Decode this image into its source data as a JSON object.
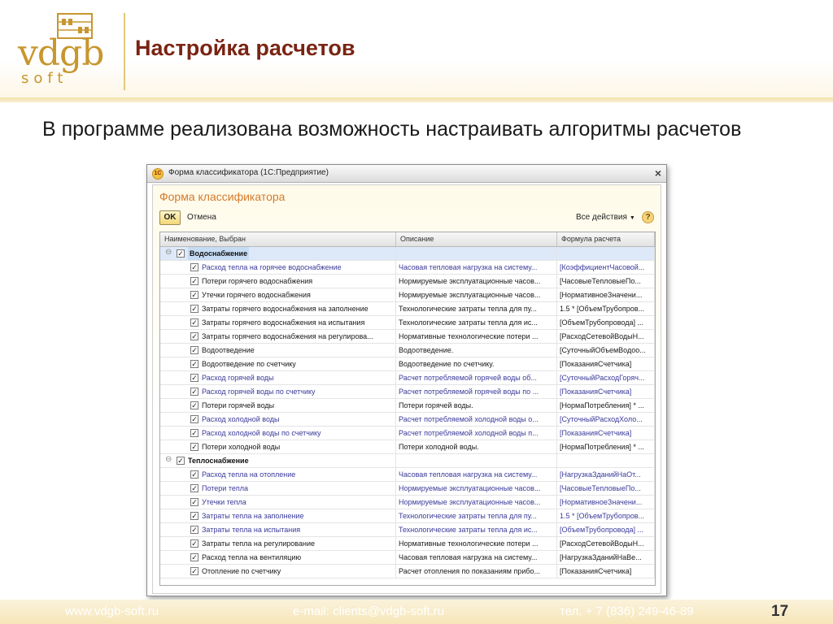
{
  "header": {
    "logo_text": "vdgb",
    "logo_sub": "soft",
    "title": "Настройка расчетов"
  },
  "body_text": "В программе реализована возможность настраивать алгоритмы расчетов",
  "window": {
    "app_icon": "1С",
    "title": "Форма классификатора  (1С:Предприятие)",
    "close_icon": "×",
    "form_title": "Форма классификатора",
    "toolbar": {
      "ok_label": "OK",
      "cancel_label": "Отмена",
      "actions_label": "Все действия",
      "help_label": "?"
    },
    "columns": [
      "Наименование, Выбран",
      "Описание",
      "Формула расчета"
    ],
    "rows": [
      {
        "type": "group",
        "name": "Водоснабжение",
        "desc": "",
        "formula": "",
        "checked": true
      },
      {
        "type": "child",
        "style": "link",
        "name": "Расход тепла на горячее водоснабжение",
        "desc": "Часовая тепловая нагрузка на систему...",
        "formula": "[КоэффициентЧасовой...",
        "checked": true
      },
      {
        "type": "child",
        "style": "plain",
        "name": "Потери горячего водоснабжения",
        "desc": "Нормируемые эксплуатационные часов...",
        "formula": "[ЧасовыеТепловыеПо...",
        "checked": true
      },
      {
        "type": "child",
        "style": "plain",
        "name": "Утечки горячего водоснабжения",
        "desc": "Нормируемые эксплуатационные часов...",
        "formula": "[НормативноеЗначени...",
        "checked": true
      },
      {
        "type": "child",
        "style": "plain",
        "name": "Затраты горячего водоснабжения на заполнение",
        "desc": "Технологические затраты тепла для пу...",
        "formula": "1.5 * [ОбъемТрубопров...",
        "checked": true
      },
      {
        "type": "child",
        "style": "plain",
        "name": "Затраты горячего водоснабжения на испытания",
        "desc": "Технологические затраты тепла для ис...",
        "formula": "[ОбъемТрубопровода] ...",
        "checked": true
      },
      {
        "type": "child",
        "style": "plain",
        "name": "Затраты горячего водоснабжения на регулирова...",
        "desc": "Нормативные технологические потери ...",
        "formula": "[РасходСетевойВодыН...",
        "checked": true
      },
      {
        "type": "child",
        "style": "plain",
        "name": "Водоотведение",
        "desc": "Водоотведение.",
        "formula": "[СуточныйОбъемВодоо...",
        "checked": true
      },
      {
        "type": "child",
        "style": "plain",
        "name": "Водоотведение по счетчику",
        "desc": "Водоотведение по счетчику.",
        "formula": "[ПоказанияСчетчика]",
        "checked": true
      },
      {
        "type": "child",
        "style": "link",
        "name": "Расход горячей воды",
        "desc": "Расчет потребляемой горячей воды об...",
        "formula": "[СуточныйРасходГоряч...",
        "checked": true
      },
      {
        "type": "child",
        "style": "link",
        "name": "Расход горячей воды по счетчику",
        "desc": "Расчет потребляемой горячей воды по ...",
        "formula": "[ПоказанияСчетчика]",
        "checked": true
      },
      {
        "type": "child",
        "style": "plain",
        "name": "Потери горячей воды",
        "desc": "Потери горячей воды.",
        "formula": "[НормаПотребления] * ...",
        "checked": true
      },
      {
        "type": "child",
        "style": "link",
        "name": "Расход холодной воды",
        "desc": "Расчет потребляемой холодной воды о...",
        "formula": "[СуточныйРасходХоло...",
        "checked": true
      },
      {
        "type": "child",
        "style": "link",
        "name": "Расход холодной воды по счетчику",
        "desc": "Расчет потребляемой холодной воды п...",
        "formula": "[ПоказанияСчетчика]",
        "checked": true
      },
      {
        "type": "child",
        "style": "plain",
        "name": "Потери холодной воды",
        "desc": "Потери холодной воды.",
        "formula": "[НормаПотребления] * ...",
        "checked": true
      },
      {
        "type": "group",
        "name": "Теплоснабжение",
        "desc": "",
        "formula": "",
        "checked": true
      },
      {
        "type": "child",
        "style": "link",
        "name": "Расход тепла на отопление",
        "desc": "Часовая тепловая нагрузка на систему...",
        "formula": "[НагрузкаЗданийНаОт...",
        "checked": true
      },
      {
        "type": "child",
        "style": "link",
        "name": "Потери тепла",
        "desc": "Нормируемые эксплуатационные часов...",
        "formula": "[ЧасовыеТепловыеПо...",
        "checked": true
      },
      {
        "type": "child",
        "style": "link",
        "name": "Утечки тепла",
        "desc": "Нормируемые эксплуатационные часов...",
        "formula": "[НормативноеЗначени...",
        "checked": true
      },
      {
        "type": "child",
        "style": "link",
        "name": "Затраты тепла на заполнение",
        "desc": "Технологические затраты тепла для пу...",
        "formula": "1.5 * [ОбъемТрубопров...",
        "checked": true
      },
      {
        "type": "child",
        "style": "link",
        "name": "Затраты тепла на испытания",
        "desc": "Технологические затраты тепла для ис...",
        "formula": "[ОбъемТрубопровода] ...",
        "checked": true
      },
      {
        "type": "child",
        "style": "plain",
        "name": "Затраты тепла на регулирование",
        "desc": "Нормативные технологические потери ...",
        "formula": "[РасходСетевойВодыН...",
        "checked": true
      },
      {
        "type": "child",
        "style": "plain",
        "name": "Расход тепла на вентиляцию",
        "desc": "Часовая тепловая нагрузка на систему...",
        "formula": "[НагрузкаЗданийНаВе...",
        "checked": true
      },
      {
        "type": "child",
        "style": "plain",
        "name": "Отопление по счетчику",
        "desc": "Расчет отопления по показаниям прибо...",
        "formula": "[ПоказанияСчетчика]",
        "checked": true
      }
    ]
  },
  "footer": {
    "site": "www.vdgb-soft.ru",
    "email": "e-mail: clients@vdgb-soft.ru",
    "phone": "тел. + 7 (836) 249-46-89",
    "page_number": "17"
  },
  "colors": {
    "title": "#7a2413",
    "logo": "#c8962e",
    "form_title": "#d47a2a",
    "link_text": "#3a3a9a",
    "selection": "#dde9f8"
  }
}
